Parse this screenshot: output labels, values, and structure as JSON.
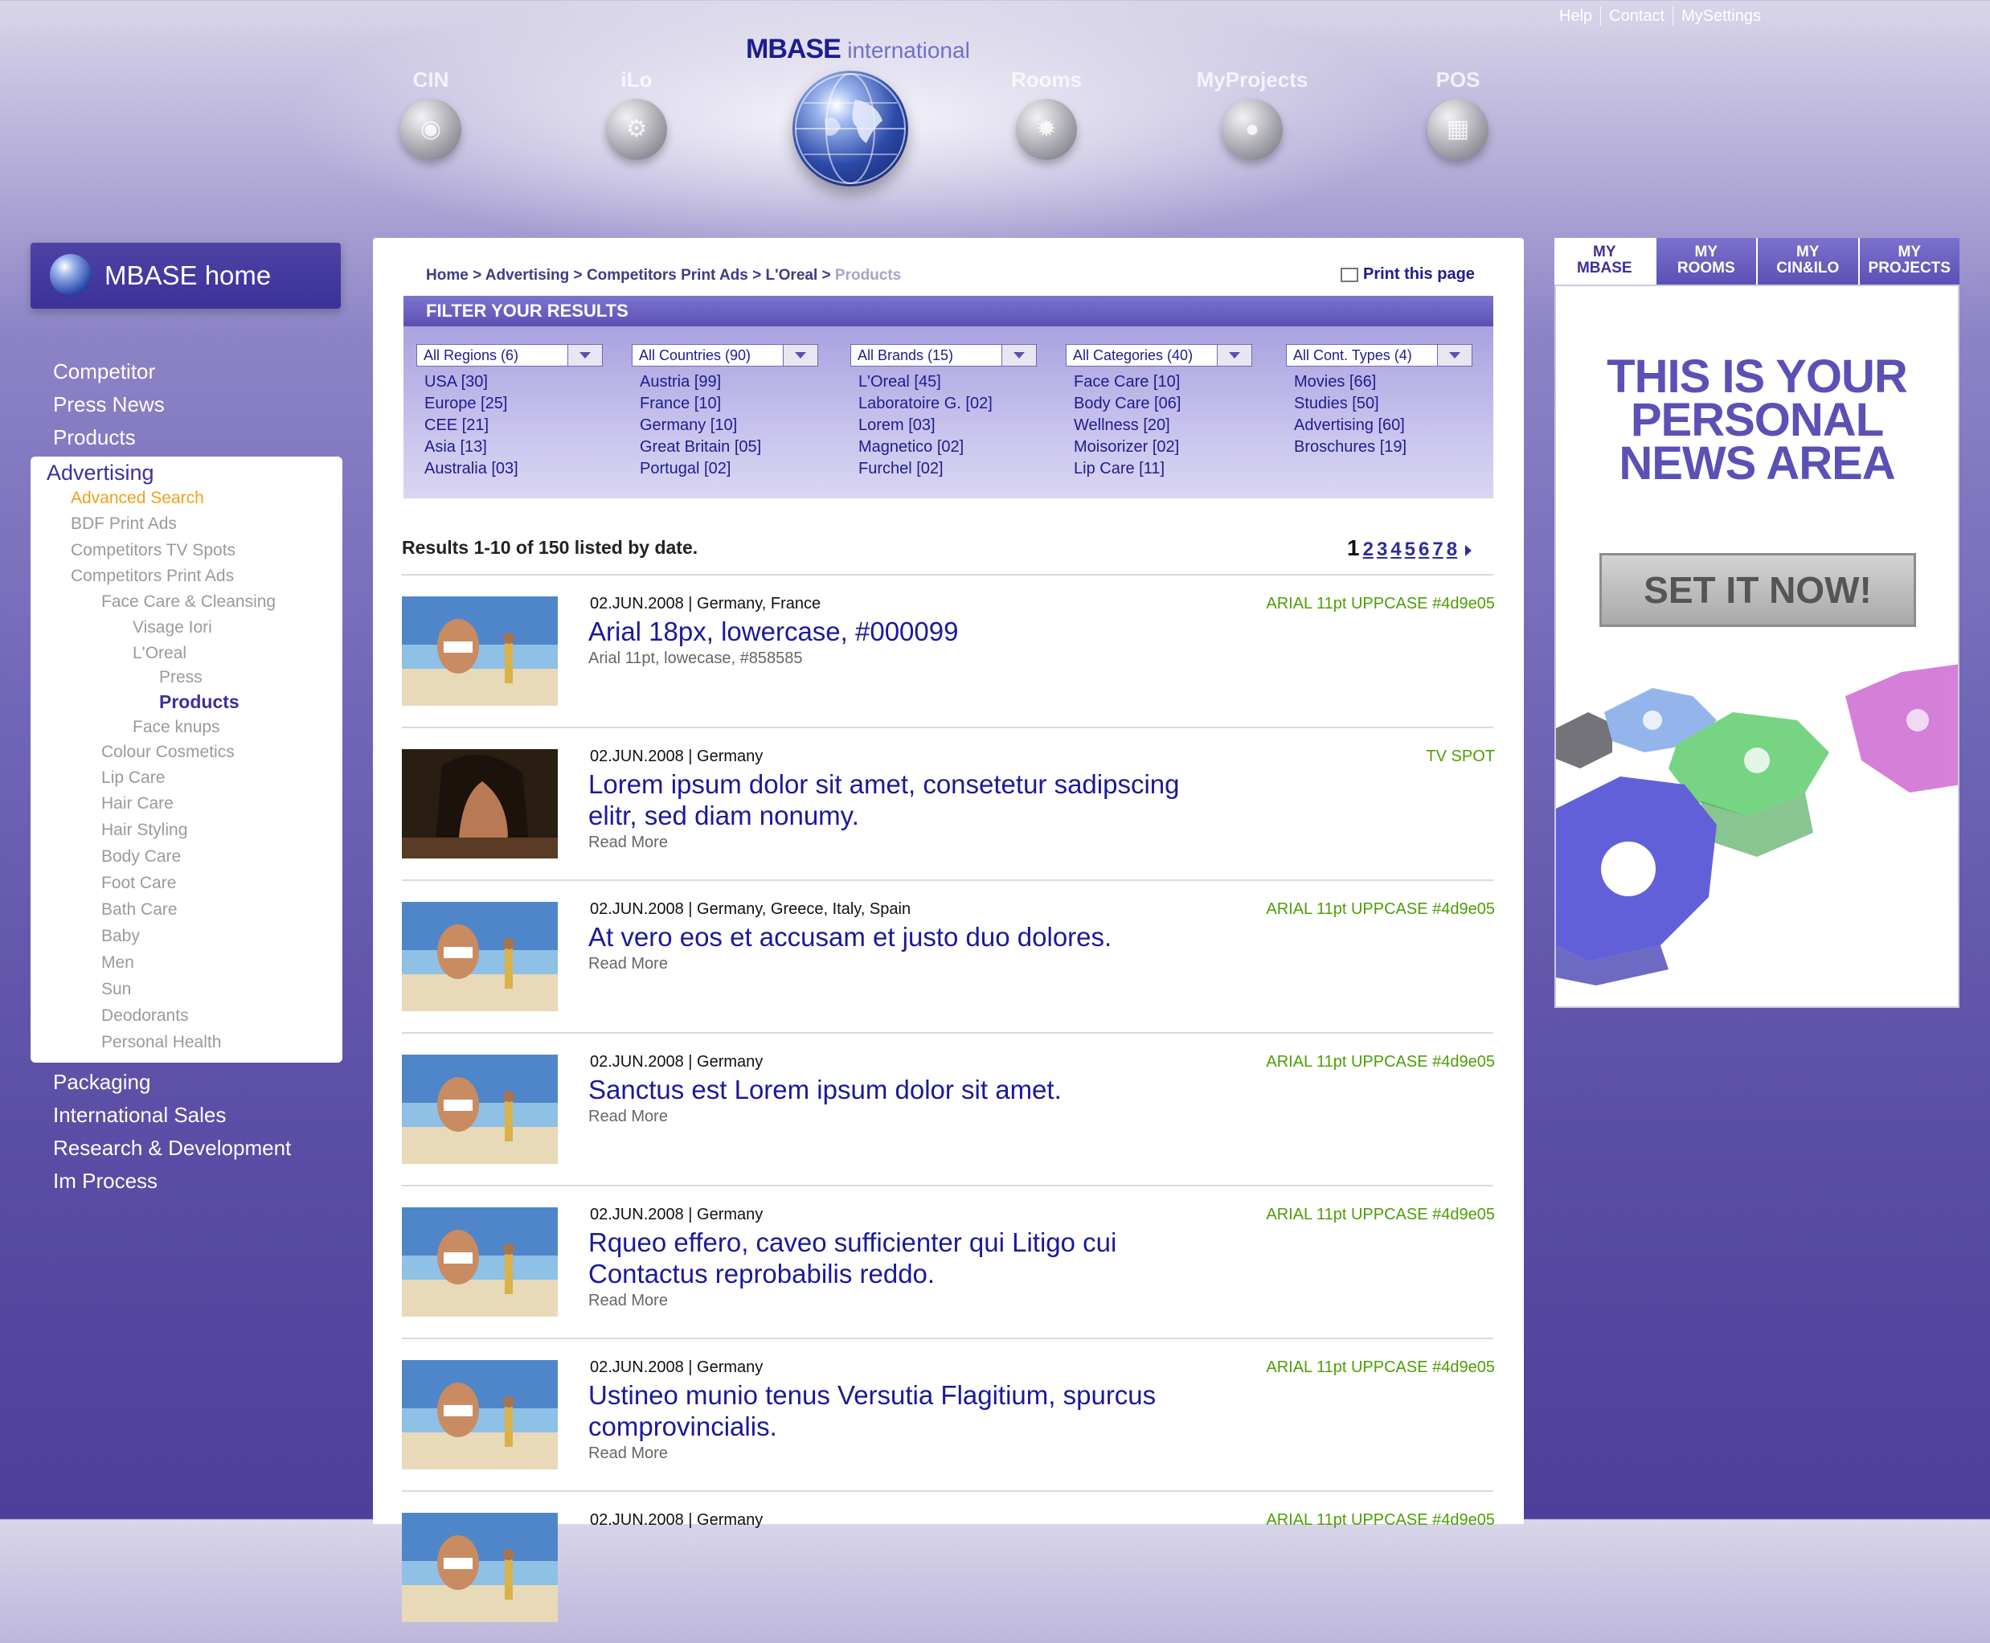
{
  "header": {
    "links": [
      "Help",
      "Contact",
      "MySettings"
    ],
    "logo_main": "MBASE",
    "logo_sub": "international",
    "nav": [
      {
        "label": "CIN",
        "icon": "cin-icon"
      },
      {
        "label": "iLo",
        "icon": "ilo-icon"
      },
      {
        "label": "Rooms",
        "icon": "rooms-icon"
      },
      {
        "label": "MyProjects",
        "icon": "myprojects-icon"
      },
      {
        "label": "POS",
        "icon": "pos-icon"
      }
    ]
  },
  "sidebar": {
    "home_label": "MBASE home",
    "top_items": [
      "Competitor",
      "Press News",
      "Products"
    ],
    "active_section": "Advertising",
    "sub_items": [
      {
        "label": "Advanced Search",
        "level": 1,
        "state": "orange"
      },
      {
        "label": "BDF Print Ads",
        "level": 1
      },
      {
        "label": "Competitors TV Spots",
        "level": 1
      },
      {
        "label": "Competitors Print Ads",
        "level": 1
      },
      {
        "label": "Face Care & Cleansing",
        "level": 2
      },
      {
        "label": "Visage Iori",
        "level": 3
      },
      {
        "label": "L'Oreal",
        "level": 3
      },
      {
        "label": "Press",
        "level": 4
      },
      {
        "label": "Products",
        "level": 4,
        "state": "active"
      },
      {
        "label": "Face knups",
        "level": 3
      },
      {
        "label": "Colour Cosmetics",
        "level": 2
      },
      {
        "label": "Lip Care",
        "level": 2
      },
      {
        "label": "Hair Care",
        "level": 2
      },
      {
        "label": "Hair Styling",
        "level": 2
      },
      {
        "label": "Body Care",
        "level": 2
      },
      {
        "label": "Foot Care",
        "level": 2
      },
      {
        "label": "Bath Care",
        "level": 2
      },
      {
        "label": "Baby",
        "level": 2
      },
      {
        "label": "Men",
        "level": 2
      },
      {
        "label": "Sun",
        "level": 2
      },
      {
        "label": "Deodorants",
        "level": 2
      },
      {
        "label": "Personal Health",
        "level": 2
      }
    ],
    "bottom_items": [
      "Packaging",
      "International Sales",
      "Research & Development",
      "Im Process"
    ]
  },
  "main": {
    "breadcrumb": [
      "Home",
      "Advertising",
      "Competitors Print Ads",
      "L'Oreal"
    ],
    "breadcrumb_current": "Products",
    "print_label": "Print this page",
    "filter_title": "FILTER YOUR RESULTS",
    "filters": [
      {
        "select": "All Regions (6)",
        "options": [
          "USA [30]",
          "Europe [25]",
          "CEE [21]",
          "Asia [13]",
          "Australia [03]"
        ]
      },
      {
        "select": "All Countries (90)",
        "options": [
          "Austria [99]",
          "France [10]",
          "Germany [10]",
          "Great Britain [05]",
          "Portugal [02]"
        ]
      },
      {
        "select": "All Brands (15)",
        "options": [
          "L'Oreal [45]",
          "Laboratoire G. [02]",
          "Lorem [03]",
          "Magnetico [02]",
          "Furchel [02]"
        ]
      },
      {
        "select": "All Categories (40)",
        "options": [
          "Face Care [10]",
          "Body Care [06]",
          "Wellness [20]",
          "Moisorizer [02]",
          "Lip Care [11]"
        ]
      },
      {
        "select": "All Cont. Types (4)",
        "options": [
          "Movies [66]",
          "Studies [50]",
          "Advertising [60]",
          "Broschures [19]"
        ]
      }
    ],
    "results_text": "Results 1-10 of 150 listed by date.",
    "pager": [
      "1",
      "2",
      "3",
      "4",
      "5",
      "6",
      "7",
      "8"
    ],
    "pager_current": "1",
    "results": [
      {
        "meta": "02.JUN.2008 | Germany, France",
        "title": "Arial 18px, lowercase, #000099",
        "sub": "Arial 11pt, lowecase, #858585",
        "tag": "ARIAL 11pt UPPCASE #4d9e05",
        "img": "beach"
      },
      {
        "meta": "02.JUN.2008 | Germany",
        "title": "Lorem ipsum dolor sit amet, consetetur sadipscing elitr, sed diam nonumy.",
        "sub": "Read More",
        "tag": "TV SPOT",
        "img": "portrait"
      },
      {
        "meta": "02.JUN.2008 | Germany, Greece, Italy, Spain",
        "title": "At vero eos et accusam et justo duo dolores.",
        "sub": "Read More",
        "tag": "ARIAL 11pt UPPCASE #4d9e05",
        "img": "beach"
      },
      {
        "meta": "02.JUN.2008 | Germany",
        "title": "Sanctus est Lorem ipsum dolor sit amet.",
        "sub": "Read More",
        "tag": "ARIAL 11pt UPPCASE #4d9e05",
        "img": "beach"
      },
      {
        "meta": "02.JUN.2008 | Germany",
        "title": "Rqueo effero, caveo sufficienter qui Litigo cui Contactus reprobabilis reddo.",
        "sub": "Read More",
        "tag": "ARIAL 11pt UPPCASE #4d9e05",
        "img": "beach"
      },
      {
        "meta": "02.JUN.2008 | Germany",
        "title": "Ustineo munio tenus Versutia Flagitium, spurcus comprovincialis.",
        "sub": "Read More",
        "tag": "ARIAL 11pt UPPCASE #4d9e05",
        "img": "beach"
      },
      {
        "meta": "02.JUN.2008 | Germany",
        "title": "",
        "sub": "",
        "tag": "ARIAL 11pt UPPCASE #4d9e05",
        "img": "beach"
      }
    ]
  },
  "right_panel": {
    "tabs": [
      [
        "MY",
        "MBASE"
      ],
      [
        "MY",
        "ROOMS"
      ],
      [
        "MY",
        "CIN&ILO"
      ],
      [
        "MY",
        "PROJECTS"
      ]
    ],
    "active_tab": 0,
    "headline": [
      "THIS IS YOUR",
      "PERSONAL",
      "NEWS AREA"
    ],
    "cta": "SET IT NOW!"
  },
  "colors": {
    "title_blue": "#1a1a99",
    "tag_green": "#4d9e05",
    "accent_purple": "#5b50b5",
    "nav_orange": "#f2a01a"
  }
}
